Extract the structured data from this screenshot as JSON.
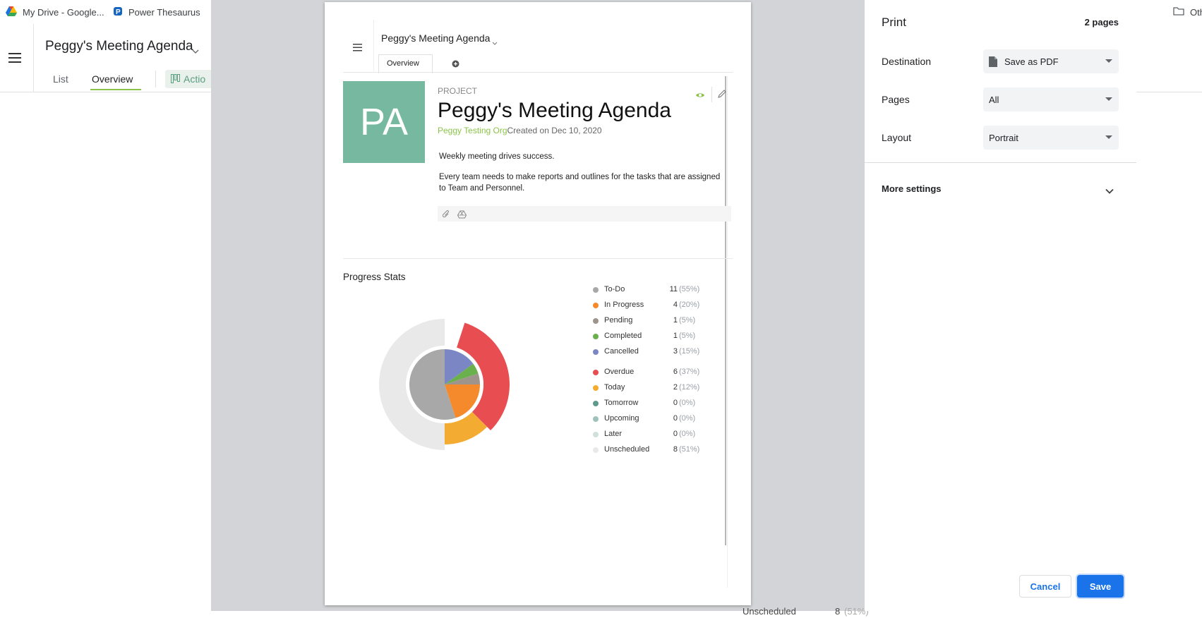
{
  "bookmarks": [
    {
      "label": "My Drive - Google...",
      "icon": "google-drive-icon"
    },
    {
      "label": "Power Thesaurus",
      "icon": "power-thesaurus-icon"
    },
    {
      "label": "Oth",
      "icon": "folder-icon"
    }
  ],
  "app": {
    "title": "Peggy's Meeting Agenda",
    "tabs": [
      "List",
      "Overview",
      "Actio"
    ],
    "bottom_peek": {
      "label": "Unscheduled",
      "value": "8",
      "pct": "(51%)"
    }
  },
  "preview": {
    "title": "Peggy's Meeting Agenda",
    "tabs": [
      "Overview"
    ],
    "avatar_initials": "PA",
    "project_label": "PROJECT",
    "project_name": "Peggy's Meeting Agenda",
    "org": "Peggy Testing Org",
    "created": "Created on Dec 10, 2020",
    "desc1": "Weekly meeting drives success.",
    "desc2": "Every team needs to make reports and outlines for the tasks that are assigned to Team and Personnel.",
    "stats_title": "Progress Stats",
    "colors": {
      "avatar": "#77b9a0",
      "org": "#8bc34a"
    }
  },
  "print": {
    "title": "Print",
    "pages_count": "2 pages",
    "destination_label": "Destination",
    "destination_value": "Save as PDF",
    "pages_label": "Pages",
    "pages_value": "All",
    "layout_label": "Layout",
    "layout_value": "Portrait",
    "more_settings": "More settings",
    "cancel": "Cancel",
    "save": "Save",
    "accent": "#1a73e8"
  },
  "chart_data": {
    "type": "pie",
    "title": "Progress Stats",
    "series": [
      {
        "ring": "inner",
        "items": [
          {
            "label": "To-Do",
            "value": 11,
            "pct": "(55%)",
            "color": "#a8a8a8"
          },
          {
            "label": "In Progress",
            "value": 4,
            "pct": "(20%)",
            "color": "#f58a2c"
          },
          {
            "label": "Pending",
            "value": 1,
            "pct": "(5%)",
            "color": "#9e948b"
          },
          {
            "label": "Completed",
            "value": 1,
            "pct": "(5%)",
            "color": "#6ab04c"
          },
          {
            "label": "Cancelled",
            "value": 3,
            "pct": "(15%)",
            "color": "#7a87c4"
          }
        ]
      },
      {
        "ring": "outer",
        "items": [
          {
            "label": "Overdue",
            "value": 6,
            "pct": "(37%)",
            "color": "#e84e51"
          },
          {
            "label": "Today",
            "value": 2,
            "pct": "(12%)",
            "color": "#f4ab31"
          },
          {
            "label": "Tomorrow",
            "value": 0,
            "pct": "(0%)",
            "color": "#5f9a8c"
          },
          {
            "label": "Upcoming",
            "value": 0,
            "pct": "(0%)",
            "color": "#9fc3bc"
          },
          {
            "label": "Later",
            "value": 0,
            "pct": "(0%)",
            "color": "#cfe1dc"
          },
          {
            "label": "Unscheduled",
            "value": 8,
            "pct": "(51%)",
            "color": "#e9e9e9"
          }
        ]
      }
    ]
  }
}
